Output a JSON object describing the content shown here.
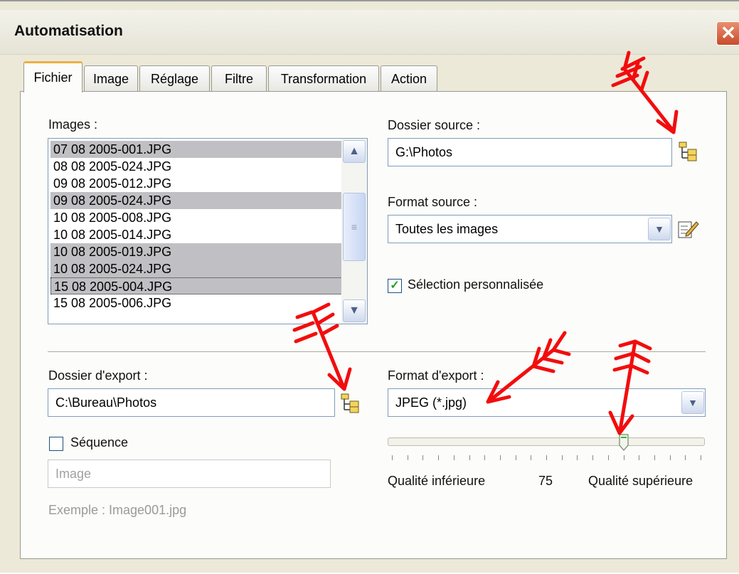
{
  "window": {
    "title": "Automatisation",
    "close_glyph": "✕"
  },
  "tabs": [
    {
      "label": "Fichier",
      "active": true
    },
    {
      "label": "Image"
    },
    {
      "label": "Réglage"
    },
    {
      "label": "Filtre"
    },
    {
      "label": "Transformation"
    },
    {
      "label": "Action"
    }
  ],
  "images": {
    "label": "Images :",
    "items": [
      {
        "name": "07 08 2005-001.JPG",
        "selected": true
      },
      {
        "name": "08 08 2005-024.JPG",
        "selected": false
      },
      {
        "name": "09 08 2005-012.JPG",
        "selected": false
      },
      {
        "name": "09 08 2005-024.JPG",
        "selected": true
      },
      {
        "name": "10 08 2005-008.JPG",
        "selected": false
      },
      {
        "name": "10 08 2005-014.JPG",
        "selected": false
      },
      {
        "name": "10 08 2005-019.JPG",
        "selected": true
      },
      {
        "name": "10 08 2005-024.JPG",
        "selected": true
      },
      {
        "name": "15 08 2005-004.JPG",
        "selected": true,
        "focused": true
      },
      {
        "name": "15 08 2005-006.JPG",
        "selected": false
      }
    ]
  },
  "source": {
    "folder_label": "Dossier source :",
    "folder_value": "G:\\Photos",
    "format_label": "Format source :",
    "format_value": "Toutes les images",
    "custom_selection_label": "Sélection personnalisée",
    "custom_selection_checked": true,
    "browse_icon": "folder-tree-icon",
    "edit_icon": "edit-pencil-icon"
  },
  "export": {
    "folder_label": "Dossier d'export :",
    "folder_value": "C:\\Bureau\\Photos",
    "sequence_label": "Séquence",
    "sequence_checked": false,
    "sequence_placeholder": "Image",
    "example_text": "Exemple : Image001.jpg",
    "format_label": "Format d'export :",
    "format_value": "JPEG (*.jpg)"
  },
  "quality": {
    "value": 75,
    "value_label": "75",
    "min_label": "Qualité inférieure",
    "max_label": "Qualité supérieure"
  },
  "colors": {
    "arrow": "#f20d0d",
    "tab_highlight": "#f0b040",
    "selection": "#c0c0c4"
  }
}
